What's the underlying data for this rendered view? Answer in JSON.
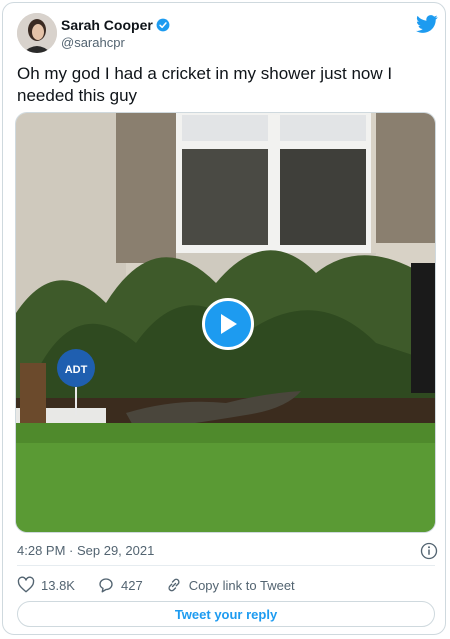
{
  "tweet": {
    "author_name": "Sarah Cooper",
    "author_handle": "@sarahcpr",
    "text": "Oh my god I had a cricket in my shower just now I needed this guy",
    "timestamp": "4:28 PM · Sep 29, 2021"
  },
  "media": {
    "sign_text": "ADT"
  },
  "actions": {
    "likes": "13.8K",
    "replies": "427",
    "copy_link": "Copy link to Tweet",
    "reply_button": "Tweet your reply"
  },
  "icons": [
    "verified-badge-icon",
    "twitter-bird-icon",
    "play-icon",
    "info-icon",
    "heart-icon",
    "reply-bubble-icon",
    "link-icon"
  ],
  "colors": {
    "accent": "#1d9bf0",
    "text": "#0f1419",
    "muted": "#536471"
  }
}
